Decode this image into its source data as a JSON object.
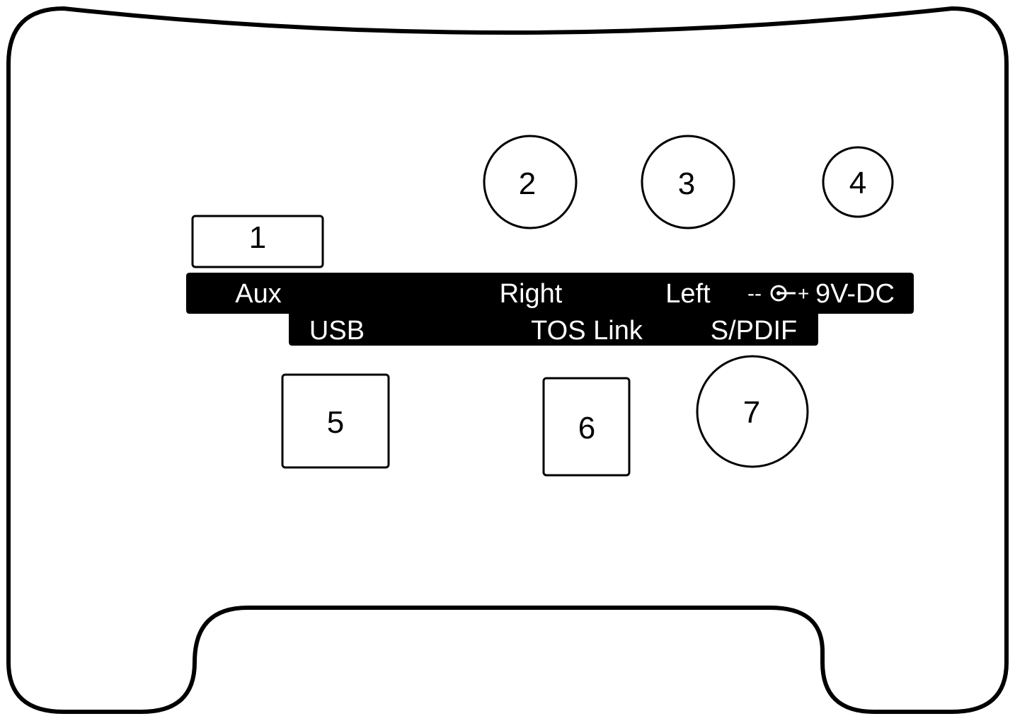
{
  "panel": {
    "ports": {
      "aux": "1",
      "right": "2",
      "left": "3",
      "dc": "4",
      "usb": "5",
      "tos": "6",
      "spdif": "7"
    },
    "labels": {
      "aux": "Aux",
      "right": "Right",
      "left": "Left",
      "dc": "9V-DC",
      "usb": "USB",
      "tos": "TOS Link",
      "spdif": "S/PDIF"
    },
    "polarity": {
      "minus": "--",
      "plus": "+"
    }
  },
  "colors": {
    "ink": "#000000",
    "paper": "#ffffff"
  }
}
